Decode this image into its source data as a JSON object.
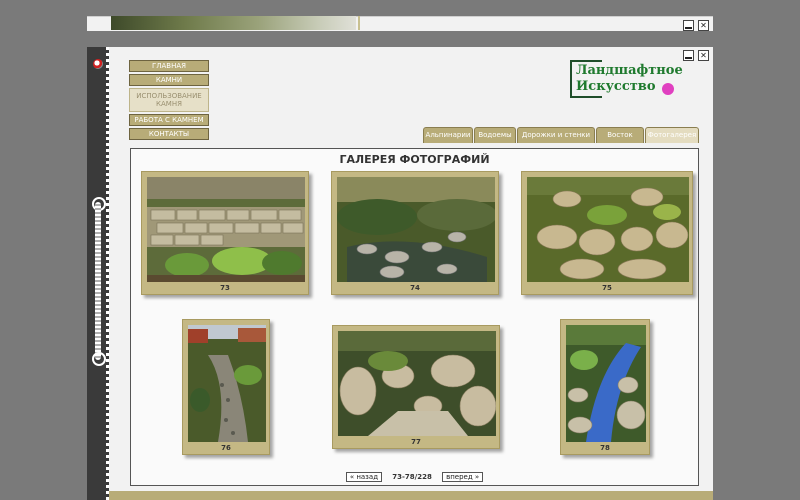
{
  "nav": {
    "items": [
      {
        "label": "ГЛАВНАЯ",
        "state": "normal"
      },
      {
        "label": "КАМНИ",
        "state": "normal"
      },
      {
        "label": "ИСПОЛЬЗОВАНИЕ КАМНЯ",
        "state": "inactive"
      },
      {
        "label": "РАБОТА С КАМНЕМ",
        "state": "normal"
      },
      {
        "label": "КОНТАКТЫ",
        "state": "normal"
      }
    ]
  },
  "logo": {
    "line1": "Ландшафтное",
    "line2": "Искусство"
  },
  "tabs": [
    {
      "label": "Альпинарии"
    },
    {
      "label": "Водоемы"
    },
    {
      "label": "Дорожки и стенки"
    },
    {
      "label": "Восток"
    },
    {
      "label": "Фотогалерея",
      "active": true
    }
  ],
  "gallery": {
    "title": "ГАЛЕРЕЯ ФОТОГРАФИЙ",
    "photos": [
      {
        "caption": "73"
      },
      {
        "caption": "74"
      },
      {
        "caption": "75"
      },
      {
        "caption": "76"
      },
      {
        "caption": "77"
      },
      {
        "caption": "78"
      }
    ]
  },
  "pager": {
    "prev_label": "« назад",
    "count": "73-78/228",
    "next_label": "вперед »"
  },
  "colors": {
    "accent": "#b8ac78",
    "frame": "#c4b884",
    "background": "#7a7a7a"
  }
}
